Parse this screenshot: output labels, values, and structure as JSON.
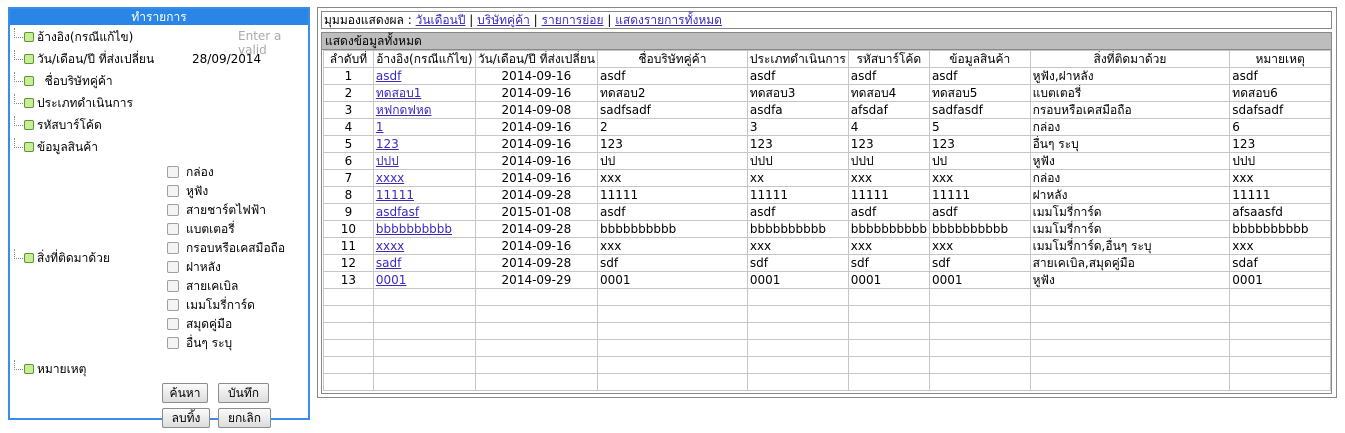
{
  "panel": {
    "title": "ทำรายการ",
    "fields": {
      "ref": "อ้างอิง(กรณีแก้ไข)",
      "date": "วัน/เดือน/ปี ที่ส่งเปลี่ยน",
      "company": "ชื่อบริษัทคู่ค้า",
      "op_type": "ประเภทดำเนินการ",
      "barcode": "รหัสบาร์โค้ด",
      "product": "ข้อมูลสินค้า",
      "attached": "สิ่งที่ติดมาด้วย",
      "note": "หมายเหตุ"
    },
    "ref_placeholder": "Enter a valid",
    "date_value": "28/09/2014",
    "checkboxes": [
      "กล่อง",
      "หูฟัง",
      "สายชาร์ตไฟฟ้า",
      "แบตเตอรี่",
      "กรอบหรือเคสมือถือ",
      "ฝาหลัง",
      "สายเคเบิล",
      "เมมโมรี่การ์ด",
      "สมุดคู่มือ",
      "อื่นๆ ระบุ"
    ],
    "buttons": {
      "search": "ค้นหา",
      "save": "บันทึก",
      "delete": "ลบทิ้ง",
      "cancel": "ยกเลิก"
    }
  },
  "view": {
    "prefix": "มุมมองแสดงผล :",
    "links": [
      "วันเดือนปี",
      "บริษัทคู่ค้า",
      "รายการย่อย",
      "แสดงรายการทั้งหมด"
    ],
    "sep": "|"
  },
  "grid": {
    "title": "แสดงข้อมูลทั้งหมด",
    "columns": [
      "ลำดับที่",
      "อ้างอิง(กรณีแก้ไข)",
      "วัน/เดือน/ปี ที่ส่งเปลี่ยน",
      "ชื่อบริษัทคู่ค้า",
      "ประเภทดำเนินการ",
      "รหัสบาร์โค้ด",
      "ข้อมูลสินค้า",
      "สิ่งที่ติดมาด้วย",
      "หมายเหตุ"
    ],
    "rows": [
      [
        "1",
        "asdf",
        "2014-09-16",
        "asdf",
        "asdf",
        "asdf",
        "asdf",
        "หูฟัง,ฝาหลัง",
        "asdf"
      ],
      [
        "2",
        "ทดสอบ1",
        "2014-09-16",
        "ทดสอบ2",
        "ทดสอบ3",
        "ทดสอบ4",
        "ทดสอบ5",
        "แบตเตอรี่",
        "ทดสอบ6"
      ],
      [
        "3",
        "หฟกดฟหด",
        "2014-09-08",
        "sadfsadf",
        "asdfa",
        "afsdaf",
        "sadfasdf",
        "กรอบหรือเคสมือถือ",
        "sdafsadf"
      ],
      [
        "4",
        "1",
        "2014-09-16",
        "2",
        "3",
        "4",
        "5",
        "กล่อง",
        "6"
      ],
      [
        "5",
        "123",
        "2014-09-16",
        "123",
        "123",
        "123",
        "123",
        "อื่นๆ ระบุ",
        "123"
      ],
      [
        "6",
        "ปปป",
        "2014-09-16",
        "ปป",
        "ปปป",
        "ปปป",
        "ปป",
        "หูฟัง",
        "ปปป"
      ],
      [
        "7",
        "xxxx",
        "2014-09-16",
        "xxx",
        "xx",
        "xxx",
        "xxx",
        "กล่อง",
        "xxx"
      ],
      [
        "8",
        "11111",
        "2014-09-28",
        "11111",
        "11111",
        "11111",
        "11111",
        "ฝาหลัง",
        "11111"
      ],
      [
        "9",
        "asdfasf",
        "2015-01-08",
        "asdf",
        "asdf",
        "asdf",
        "asdf",
        "เมมโมรี่การ์ด",
        "afsaasfd"
      ],
      [
        "10",
        "bbbbbbbbbb",
        "2014-09-28",
        "bbbbbbbbbb",
        "bbbbbbbbbb",
        "bbbbbbbbbb",
        "bbbbbbbbbb",
        "เมมโมรี่การ์ด",
        "bbbbbbbbbb"
      ],
      [
        "11",
        "xxxx",
        "2014-09-16",
        "xxx",
        "xxx",
        "xxx",
        "xxx",
        "เมมโมรี่การ์ด,อื่นๆ ระบุ",
        "xxx"
      ],
      [
        "12",
        "sadf",
        "2014-09-28",
        "sdf",
        "sdf",
        "sdf",
        "sdf",
        "สายเคเบิล,สมุดคู่มือ",
        "sdaf"
      ],
      [
        "13",
        "0001",
        "2014-09-29",
        "0001",
        "0001",
        "0001",
        "0001",
        "หูฟัง",
        "0001"
      ]
    ],
    "empty_rows": 6
  }
}
